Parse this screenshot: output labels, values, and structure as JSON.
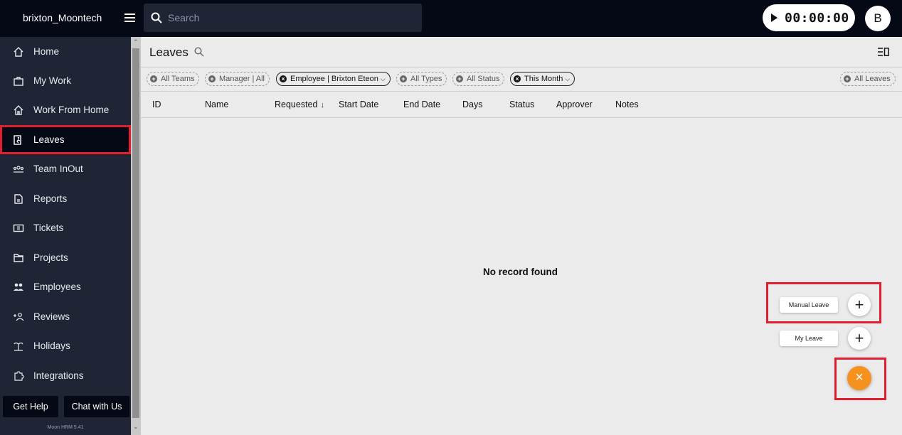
{
  "app": {
    "brand": "brixton_Moontech",
    "timer": "00:00:00",
    "avatar_initial": "B",
    "version": "Moon HRM 5.41"
  },
  "search": {
    "placeholder": "Search"
  },
  "sidebar": {
    "items": [
      {
        "label": "Home",
        "icon": "home-icon"
      },
      {
        "label": "My Work",
        "icon": "briefcase-icon"
      },
      {
        "label": "Work From Home",
        "icon": "house-icon"
      },
      {
        "label": "Leaves",
        "icon": "exit-icon",
        "active": true
      },
      {
        "label": "Team InOut",
        "icon": "team-icon"
      },
      {
        "label": "Reports",
        "icon": "document-icon"
      },
      {
        "label": "Tickets",
        "icon": "ticket-icon"
      },
      {
        "label": "Projects",
        "icon": "folder-icon"
      },
      {
        "label": "Employees",
        "icon": "people-icon"
      },
      {
        "label": "Reviews",
        "icon": "review-icon"
      },
      {
        "label": "Holidays",
        "icon": "beach-icon"
      },
      {
        "label": "Integrations",
        "icon": "puzzle-icon"
      }
    ],
    "get_help": "Get Help",
    "chat": "Chat with Us"
  },
  "page": {
    "title": "Leaves"
  },
  "filters": {
    "teams": "All Teams",
    "manager": "Manager | All",
    "employee": "Employee | Brixton Eteon",
    "types": "All Types",
    "status": "All Status",
    "month": "This Month",
    "leaves": "All Leaves"
  },
  "table": {
    "columns": [
      "ID",
      "Name",
      "Requested",
      "Start Date",
      "End Date",
      "Days",
      "Status",
      "Approver",
      "Notes"
    ],
    "empty_message": "No record found"
  },
  "fab": {
    "manual_leave": "Manual Leave",
    "my_leave": "My Leave",
    "accent": "#f5921e"
  },
  "colors": {
    "topbar": "#040915",
    "sidebar": "#1f2535",
    "highlight": "#e0202f"
  }
}
